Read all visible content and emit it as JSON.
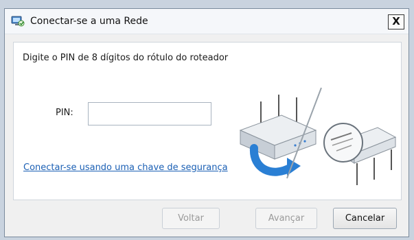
{
  "window": {
    "title": "Conectar-se a uma Rede",
    "close_label": "X"
  },
  "content": {
    "instruction": "Digite o PIN de 8 dígitos do rótulo do roteador",
    "pin_label": "PIN:",
    "pin_value": "",
    "link_text": "Conectar-se usando uma chave de segurança"
  },
  "buttons": {
    "back": "Voltar",
    "next": "Avançar",
    "cancel": "Cancelar"
  },
  "icons": {
    "title": "network-icon",
    "illustration": "router-illustration"
  },
  "colors": {
    "link": "#1a5fb4",
    "arrow": "#2a7fd4"
  }
}
